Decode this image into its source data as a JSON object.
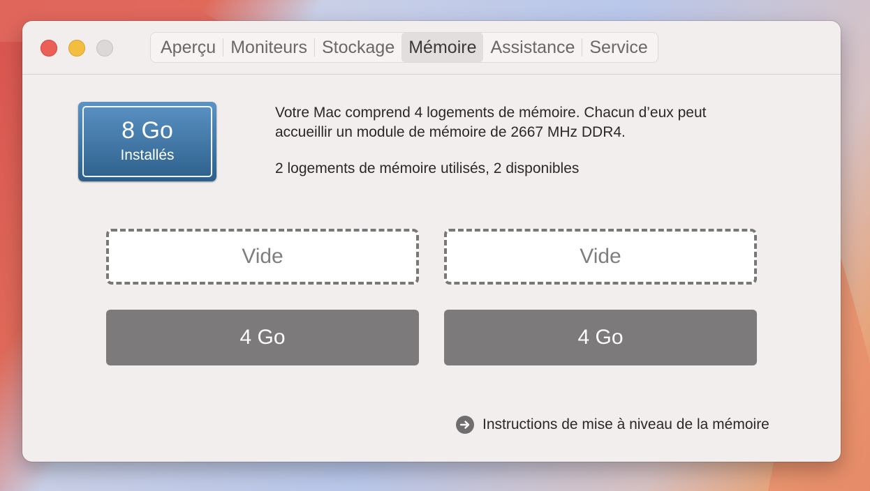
{
  "window": {
    "tabs": [
      {
        "label": "Aperçu"
      },
      {
        "label": "Moniteurs"
      },
      {
        "label": "Stockage"
      },
      {
        "label": "Mémoire",
        "selected": true
      },
      {
        "label": "Assistance"
      },
      {
        "label": "Service"
      }
    ]
  },
  "memory": {
    "installed_size": "8 Go",
    "installed_label": "Installés",
    "description_line1": "Votre Mac comprend 4 logements de mémoire. Chacun d’eux peut",
    "description_line2": "accueillir un module de mémoire de 2667 MHz DDR4.",
    "usage": "2 logements de mémoire utilisés, 2 disponibles",
    "slots": [
      {
        "label": "Vide",
        "state": "empty"
      },
      {
        "label": "Vide",
        "state": "empty"
      },
      {
        "label": "4 Go",
        "state": "filled"
      },
      {
        "label": "4 Go",
        "state": "filled"
      }
    ],
    "upgrade_link": "Instructions de mise à niveau de la mémoire"
  },
  "colors": {
    "badge_top": "#5b93c5",
    "badge_bottom": "#2d5f8a",
    "filled_slot": "#7c7a7b",
    "close_light": "#ec5f57",
    "minimize_light": "#f3bd40"
  }
}
